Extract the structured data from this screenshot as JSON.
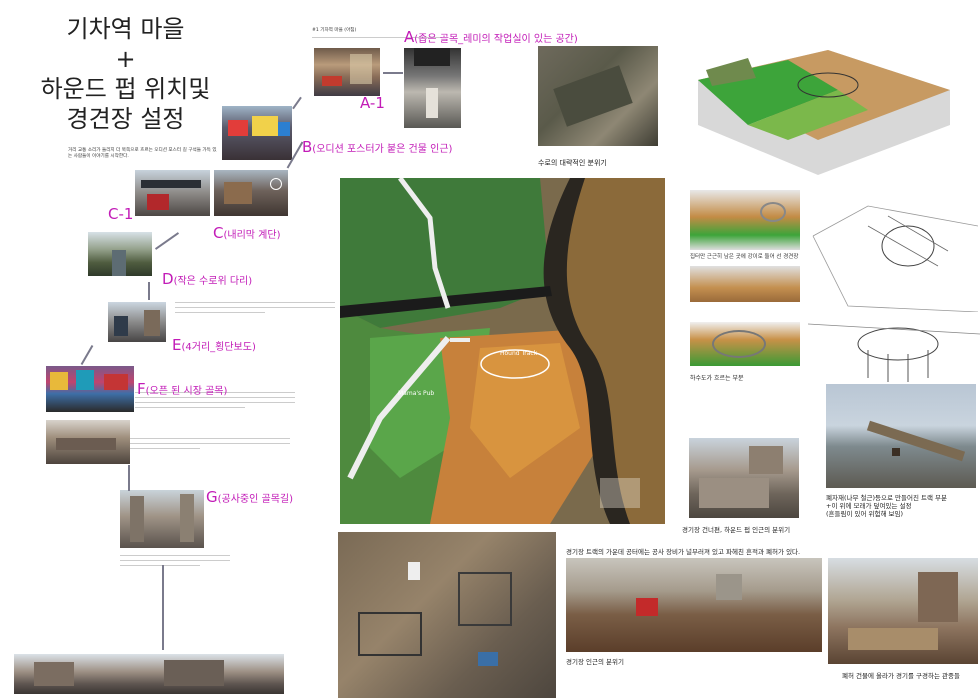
{
  "title": {
    "line1": "기차역 마을",
    "line2": "+",
    "line3": "하운드 펍 위치및",
    "line4": "경견장 설정"
  },
  "labels": {
    "A": {
      "letter": "A",
      "text": "(좁은 골목_레미의 작업실이 있는 공간)"
    },
    "A1": "A-1",
    "B": {
      "letter": "B",
      "text": "(오디션 포스터가 붙은 건물 인근)"
    },
    "C1": "C-1",
    "C": {
      "letter": "C",
      "text": "(내리막 계단)"
    },
    "D": {
      "letter": "D",
      "text": "(작은 수로위 다리)"
    },
    "E": {
      "letter": "E",
      "text": "(4거리_횡단보도)"
    },
    "F": {
      "letter": "F",
      "text": "(오픈 된 시장 골목)"
    },
    "G": {
      "letter": "G",
      "text": "(공사중인 골목길)"
    }
  },
  "notes": {
    "A": "#1 기차역 마을 (아침)",
    "B": "거리 교통 소리가 들리지 더 북쪽으로 흐르는 오디션 포스터 길 구석들 가득 있는 사람들이 이야기를 시작한다."
  },
  "captions": {
    "waterway": "수로의 대략적인 분위기",
    "corner": "집터만 근근히 남은 곳에 강이로 둘어 선 경견장",
    "sewer": "하수도가 흐르는 부분",
    "across": "경기장 건너편, 하운드 펍 인근의 분위기",
    "bridge1": "폐자재(나무 철근)등으로 만들어진 트랙 부분",
    "bridge2": "+이 위에 모래가 덮여있는 설정",
    "bridge3": "(흔들림이 있어 위험해 보임)",
    "track_top": "경기장 트랙의 가운데 공터에는 공사 장비가 널부러져 있고 파헤친 흔적과 폐허가 있다.",
    "near": "경기장 인근의 분위기",
    "ruin": "폐허 건물에 올라가 경기를 구경하는 관중들"
  },
  "map": {
    "pub": "Mama's Pub",
    "track": "Hound Track"
  },
  "colors": {
    "accent": "#c21bb7"
  }
}
